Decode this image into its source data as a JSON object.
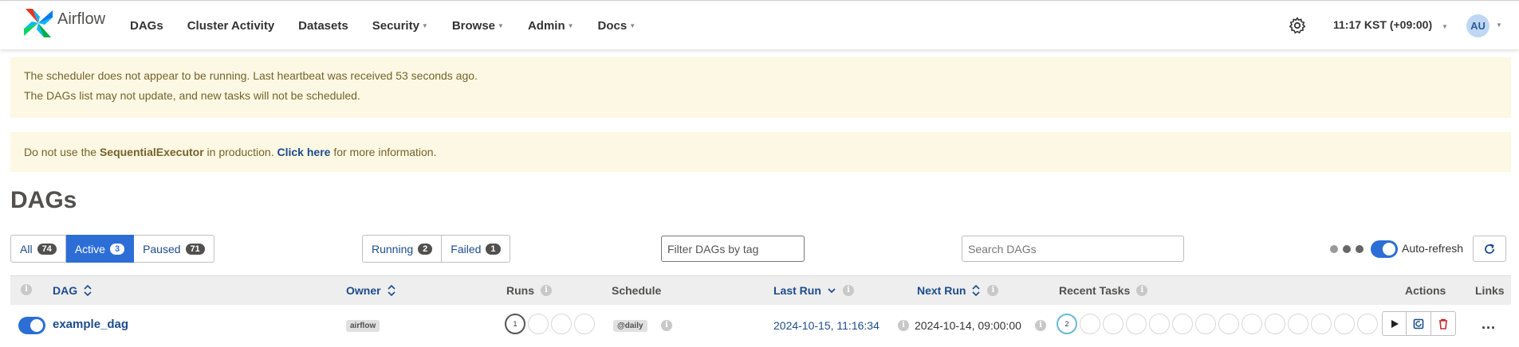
{
  "navbar": {
    "brand": "Airflow",
    "items": [
      {
        "label": "DAGs",
        "dropdown": false
      },
      {
        "label": "Cluster Activity",
        "dropdown": false
      },
      {
        "label": "Datasets",
        "dropdown": false
      },
      {
        "label": "Security",
        "dropdown": true
      },
      {
        "label": "Browse",
        "dropdown": true
      },
      {
        "label": "Admin",
        "dropdown": true
      },
      {
        "label": "Docs",
        "dropdown": true
      }
    ],
    "time": "11:17 KST (+09:00)",
    "avatar": "AU"
  },
  "alerts": {
    "scheduler_line1": "The scheduler does not appear to be running. Last heartbeat was received 53 seconds ago.",
    "scheduler_line2": "The DAGs list may not update, and new tasks will not be scheduled.",
    "executor_prefix": "Do not use the ",
    "executor_name": "SequentialExecutor",
    "executor_mid": " in production. ",
    "executor_link": "Click here",
    "executor_suffix": " for more information."
  },
  "page_title": "DAGs",
  "status_filters": [
    {
      "label": "All",
      "count": "74",
      "active": false
    },
    {
      "label": "Active",
      "count": "3",
      "active": true
    },
    {
      "label": "Paused",
      "count": "71",
      "active": false
    }
  ],
  "run_filters": [
    {
      "label": "Running",
      "count": "2"
    },
    {
      "label": "Failed",
      "count": "1"
    }
  ],
  "filter_tags_placeholder": "Filter DAGs by tag",
  "search_placeholder": "Search DAGs",
  "auto_refresh_label": "Auto-refresh",
  "table": {
    "headers": {
      "dag": "DAG",
      "owner": "Owner",
      "runs": "Runs",
      "schedule": "Schedule",
      "last_run": "Last Run",
      "next_run": "Next Run",
      "recent_tasks": "Recent Tasks",
      "actions": "Actions",
      "links": "Links"
    },
    "rows": [
      {
        "dag_id": "example_dag",
        "owner": "airflow",
        "runs_count": "1",
        "schedule": "@daily",
        "last_run": "2024-10-15, 11:16:34",
        "next_run": "2024-10-14, 09:00:00",
        "recent_tasks_count": "2",
        "links_more": "..."
      }
    ]
  },
  "colors": {
    "primary": "#2d6ed6",
    "link": "#1c4c8c",
    "alert_bg": "#fcf8e3",
    "alert_text": "#76632b",
    "danger": "#cc2a2a"
  }
}
